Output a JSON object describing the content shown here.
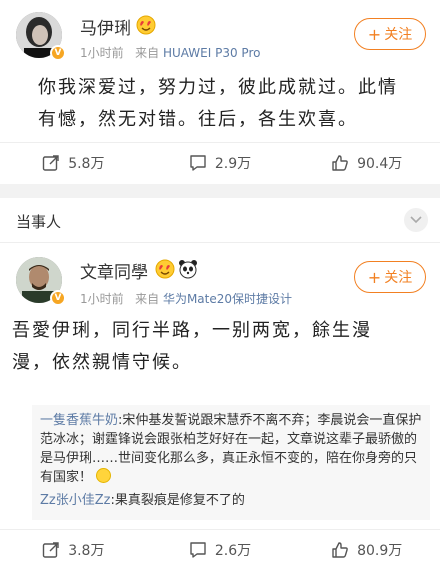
{
  "post1": {
    "username": "马伊琍",
    "time": "1小时前",
    "source_prefix": "来自",
    "source": "HUAWEI P30 Pro",
    "follow_label": "关注",
    "text": "你我深爱过，努力过，彼此成就过。此情有憾，然无对错。往后，各生欢喜。",
    "reposts": "5.8万",
    "comments": "2.9万",
    "likes": "90.4万"
  },
  "section": {
    "title": "当事人"
  },
  "post2": {
    "username": "文章同學",
    "time": "1小时前",
    "source_prefix": "来自",
    "source": "华为Mate20保时捷设计",
    "follow_label": "关注",
    "text": "吾愛伊琍，同行半路，一别两宽，餘生漫漫，依然親情守候。",
    "comments_list": [
      {
        "user": "一隻香蕉牛奶",
        "text": ":宋仲基发誓说跟宋慧乔不离不弃；李晨说会一直保护范冰冰；谢霆锋说会跟张柏芝好好在一起，文章说这辈子最骄傲的是马伊琍……世间变化那么多，真正永恒不变的，陪在你身旁的只有国家！"
      },
      {
        "user": "Zz张小佳Zz",
        "text": ":果真裂痕是修复不了的"
      }
    ],
    "reposts": "3.8万",
    "comments": "2.6万",
    "likes": "80.9万"
  },
  "colors": {
    "accent": "#f28022",
    "link": "#5d7ba5",
    "badge": "#f6a623"
  },
  "icons": [
    "repost-icon",
    "comment-icon",
    "like-icon",
    "chevron-down-icon",
    "verified-badge-icon"
  ]
}
